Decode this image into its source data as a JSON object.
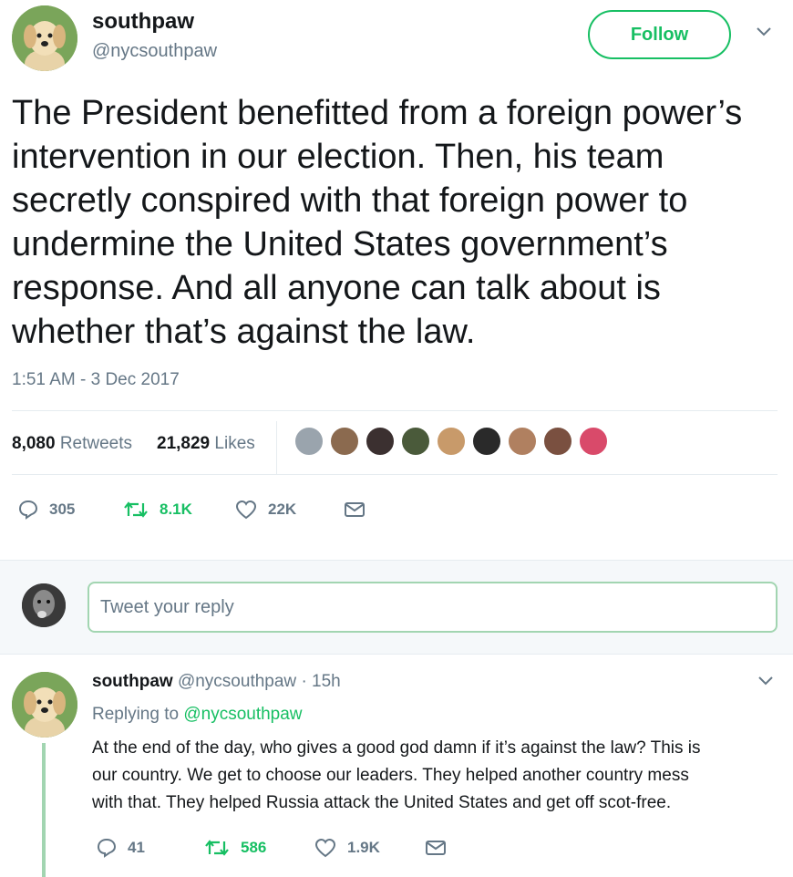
{
  "tweet": {
    "display_name": "southpaw",
    "handle": "@nycsouthpaw",
    "follow_label": "Follow",
    "text": "The President benefitted from a foreign power’s intervention in our election. Then, his team secretly conspired with that foreign power to undermine the United States government’s response. And all anyone can talk about is whether that’s against the law.",
    "timestamp": "1:51 AM - 3 Dec 2017",
    "stats": {
      "retweets_count": "8,080",
      "retweets_label": "Retweets",
      "likes_count": "21,829",
      "likes_label": "Likes"
    },
    "actions": {
      "replies": "305",
      "retweets": "8.1K",
      "likes": "22K"
    }
  },
  "liker_colors": [
    "#9aa4ad",
    "#8b6a4f",
    "#3b3030",
    "#4a5a3a",
    "#c89a6a",
    "#2a2a2a",
    "#b08060",
    "#7a5040",
    "#d94a6a"
  ],
  "reply_box": {
    "placeholder": "Tweet your reply"
  },
  "reply": {
    "display_name": "southpaw",
    "handle": "@nycsouthpaw",
    "time": "· 15h",
    "replying_prefix": "Replying to",
    "replying_to": "@nycsouthpaw",
    "text_lines": [
      "At the end of the day, who gives a good god damn if it’s against the law? This is",
      "our country. We get to choose our leaders. They helped another country mess",
      "with that. They helped Russia attack the United States and get off scot-free."
    ],
    "actions": {
      "replies": "41",
      "retweets": "586",
      "likes": "1.9K"
    }
  },
  "colors": {
    "accent_green": "#17bf63",
    "muted": "#657786",
    "divider": "#e6ecf0"
  }
}
